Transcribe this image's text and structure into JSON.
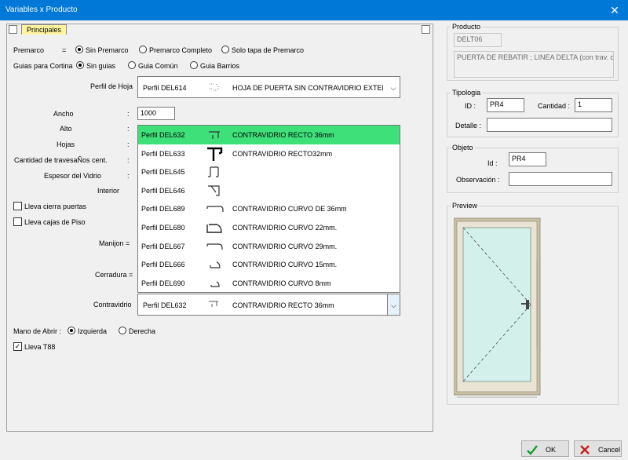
{
  "window": {
    "title": "Variables x Producto",
    "close": "✕"
  },
  "tab": {
    "label": "Principales"
  },
  "premarco": {
    "label": "Premarco",
    "eq": "=",
    "options": [
      "Sin Premarco",
      "Premarco Completo",
      "Solo tapa de Premarco"
    ],
    "selected": "Sin Premarco"
  },
  "guias": {
    "label": "Guias para Cortina",
    "options": [
      "Sin guias",
      "Guia Común",
      "Guia Barrios"
    ],
    "selected": "Sin guias"
  },
  "perfil_hoja": {
    "label": "Perfil de Hoja",
    "code": "Perfil DEL614",
    "desc": "HOJA DE PUERTA SIN CONTRAVIDRIO EXTERIC"
  },
  "fields": {
    "ancho": {
      "label": "Ancho",
      "value": "1000"
    },
    "alto": {
      "label": "Alto"
    },
    "hojas": {
      "label": "Hojas"
    },
    "travesanos": {
      "label": "Cantidad de travesaÑos cent."
    },
    "espesor": {
      "label": "Espesor del Vidrio"
    },
    "interior": {
      "label": "Interior"
    },
    "colon": ":"
  },
  "checks": {
    "cierra": "Lleva cierra puertas",
    "cajas": "Lleva cajas de Piso",
    "t88": "Lleva T88"
  },
  "manijon": {
    "label": "Manijon ="
  },
  "cerradura": {
    "label": "Cerradura ="
  },
  "dropdown": {
    "items": [
      {
        "code": "Perfil DEL632",
        "icon": "profile-632-icon",
        "desc": "CONTRAVIDRIO RECTO 36mm"
      },
      {
        "code": "Perfil DEL633",
        "icon": "profile-633-icon",
        "desc": "CONTRAVIDRIO RECTO32mm"
      },
      {
        "code": "Perfil DEL645",
        "icon": "profile-645-icon",
        "desc": ""
      },
      {
        "code": "Perfil DEL646",
        "icon": "profile-646-icon",
        "desc": ""
      },
      {
        "code": "Perfil DEL689",
        "icon": "profile-689-icon",
        "desc": "CONTRAVIDRIO CURVO DE 36mm"
      },
      {
        "code": "Perfil DEL680",
        "icon": "profile-680-icon",
        "desc": "CONTRAVIDRIO CURVO 22mm."
      },
      {
        "code": "Perfil DEL667",
        "icon": "profile-667-icon",
        "desc": "CONTRAVIDRIO CURVO 29mm."
      },
      {
        "code": "Perfil DEL666",
        "icon": "profile-666-icon",
        "desc": "CONTRAVIDRIO CURVO 15mm."
      },
      {
        "code": "Perfil DEL690",
        "icon": "profile-690-icon",
        "desc": "CONTRAVIDRIO CURVO 8mm"
      }
    ],
    "highlight_color": "#3ee07a"
  },
  "contravidrio": {
    "label": "Contravidrio",
    "code": "Perfil DEL632",
    "desc": "CONTRAVIDRIO RECTO 36mm"
  },
  "mano": {
    "label": "Mano de Abrir :",
    "options": [
      "Izquierda",
      "Derecha"
    ],
    "selected": "Izquierda"
  },
  "producto": {
    "title": "Producto",
    "code": "DELT06",
    "desc": "PUERTA DE REBATIR ; LINEA DELTA (con trav. ce"
  },
  "tipologia": {
    "title": "Tipologia",
    "id_label": "ID :",
    "id_value": "PR4",
    "cantidad_label": "Cantidad :",
    "cantidad_value": "1",
    "detalle_label": "Detalle :",
    "detalle_value": ""
  },
  "objeto": {
    "title": "Objeto",
    "id_label": "Id :",
    "id_value": "PR4",
    "obs_label": "Observación :",
    "obs_value": ""
  },
  "preview": {
    "title": "Preview"
  },
  "buttons": {
    "ok": "OK",
    "cancel": "Cancel"
  }
}
